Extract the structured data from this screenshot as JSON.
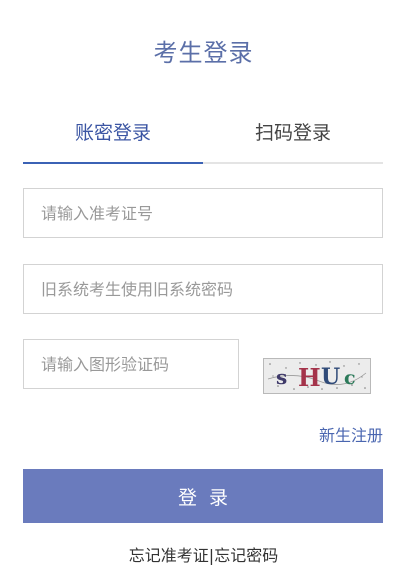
{
  "page": {
    "title": "考生登录"
  },
  "tabs": [
    {
      "label": "账密登录",
      "active": true
    },
    {
      "label": "扫码登录",
      "active": false
    }
  ],
  "form": {
    "exam_id_placeholder": "请输入准考证号",
    "exam_id_value": "",
    "password_placeholder": "旧系统考生使用旧系统密码",
    "password_value": "",
    "captcha_placeholder": "请输入图形验证码",
    "captcha_value": "",
    "captcha_chars": [
      "s",
      "H",
      "U",
      "c"
    ]
  },
  "links": {
    "register": "新生注册",
    "forgot_exam_id": "忘记准考证",
    "separator": "|",
    "forgot_password": "忘记密码"
  },
  "buttons": {
    "login": "登录"
  },
  "colors": {
    "title": "#5b6fa8",
    "accent": "#3b55a3",
    "login_button": "#6a7bbd",
    "link": "#4a66b0"
  }
}
